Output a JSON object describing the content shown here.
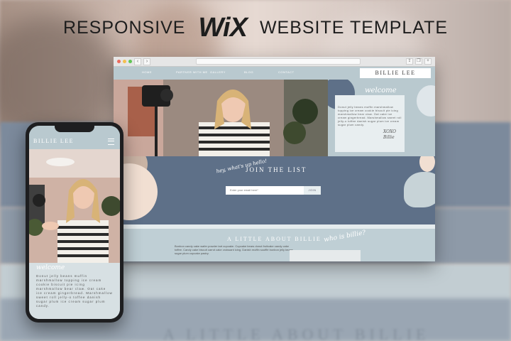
{
  "headline": {
    "before": "RESPONSIVE",
    "logo": "WiX",
    "after": "WEBSITE TEMPLATE"
  },
  "browser": {
    "nav_back": "‹",
    "nav_forward": "›",
    "site": {
      "nav_links": [
        "HOME",
        "PARTNER WITH ME",
        "GALLERY",
        "BLOG",
        "CONTACT"
      ],
      "brand": "BILLIE LEE",
      "welcome_script": "welcome",
      "welcome_body": "Donut jelly beans muffin marshmallow topping ice cream cookie biscuit pie icing marshmallow bear claw. Oat cake ice cream gingerbread. Marshmallow sweet roll jelly-o toffee danish sugar plum ice cream sugar plum candy.",
      "signoff": "XOXO",
      "signature": "Billie",
      "join_script": "hey, what's up hello!",
      "join_title": "JOIN THE LIST",
      "email_placeholder": "Enter your email here*",
      "join_button": "JOIN",
      "about_title": "A LITTLE ABOUT BILLIE",
      "about_script": "who is billie?",
      "about_body": "Bonbon candy cake wafer powder tart cupcake. Cupcake bears donut fruitcake candy cake toffee. Candy cake biscuit carrot cake croissant icing. Danish muffin soufflé bonbon jelly beans sugar plum cupcake pastry."
    }
  },
  "phone": {
    "brand": "BILLIE LEE",
    "welcome_script": "welcome",
    "body": "Donut jelly beans muffin marshmallow topping ice cream cookie biscuit pie icing marshmallow bear claw. Oat cake ice cream gingerbread. Marshmallow sweet roll jelly-o toffee danish sugar plum ice cream sugar plum candy."
  },
  "backdrop_text": "A LITTLE ABOUT BILLIE",
  "colors": {
    "slate_blue": "#5e7088",
    "light_blue": "#b9c9cf",
    "peach": "#f1dfd2",
    "text_dark": "#1d1d1d"
  }
}
